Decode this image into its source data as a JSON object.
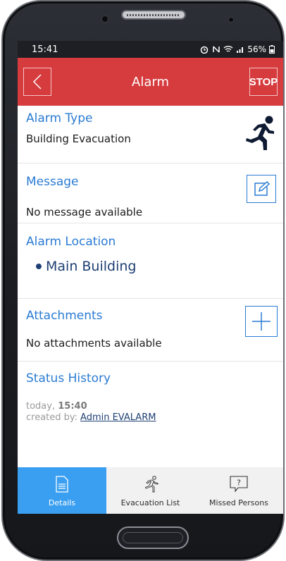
{
  "status_bar": {
    "time": "15:41",
    "battery": "56%"
  },
  "header": {
    "title": "Alarm",
    "stop_label": "STOP"
  },
  "alarm_type": {
    "title": "Alarm Type",
    "value": "Building Evacuation",
    "icon": "running-person-icon"
  },
  "message": {
    "title": "Message",
    "value": "No message available"
  },
  "location": {
    "title": "Alarm Location",
    "items": [
      "Main Building"
    ]
  },
  "attachments": {
    "title": "Attachments",
    "value": "No attachments available"
  },
  "status_history": {
    "title": "Status History",
    "day": "today,",
    "time": "15:40",
    "created_by_label": "created by:",
    "created_by_user": "Admin EVALARM"
  },
  "bottom_nav": {
    "items": [
      {
        "label": "Details",
        "icon": "document-icon",
        "active": true
      },
      {
        "label": "Evacuation List",
        "icon": "running-person-outline-icon",
        "active": false
      },
      {
        "label": "Missed Persons",
        "icon": "question-bubble-icon",
        "active": false
      }
    ]
  },
  "colors": {
    "header": "#d63b3e",
    "accent": "#2a7bd3",
    "active_tab": "#3a9ff0",
    "location_text": "#1e3f73"
  }
}
